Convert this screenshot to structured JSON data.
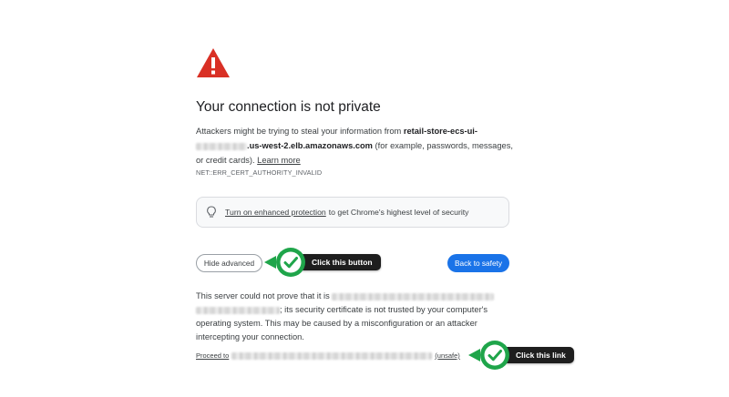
{
  "page": {
    "title": "Your connection is not private",
    "desc_intro": "Attackers might be trying to steal your information from ",
    "host_line1": "retail-store-ecs-ui-",
    "host_line2": ".us-west-2.elb.amazonaws.com",
    "desc_rest": " (for example, passwords, messages, or credit cards). ",
    "learn_more": "Learn more",
    "error_code": "NET::ERR_CERT_AUTHORITY_INVALID"
  },
  "enhanced": {
    "link": "Turn on enhanced protection",
    "rest": " to get Chrome's highest level of security"
  },
  "buttons": {
    "hide_advanced": "Hide advanced",
    "back_to_safety": "Back to safety"
  },
  "advanced": {
    "detail_start": "This server could not prove that it is ",
    "detail_rest": "; its security certificate is not trusted by your computer's operating system. This may be caused by a misconfiguration or an attacker intercepting your connection.",
    "proceed_prefix": "Proceed to ",
    "proceed_suffix": "(unsafe)"
  },
  "annotations": {
    "callout1": "Click this button",
    "callout2": "Click this link"
  },
  "icons": {
    "warning": "warning-triangle-icon",
    "bulb": "lightbulb-icon",
    "check": "check-circle-icon"
  },
  "colors": {
    "warning_red": "#d93025",
    "primary_blue": "#1a73e8",
    "callout_green": "#1fa54a",
    "callout_dark": "#1e1e1e"
  }
}
